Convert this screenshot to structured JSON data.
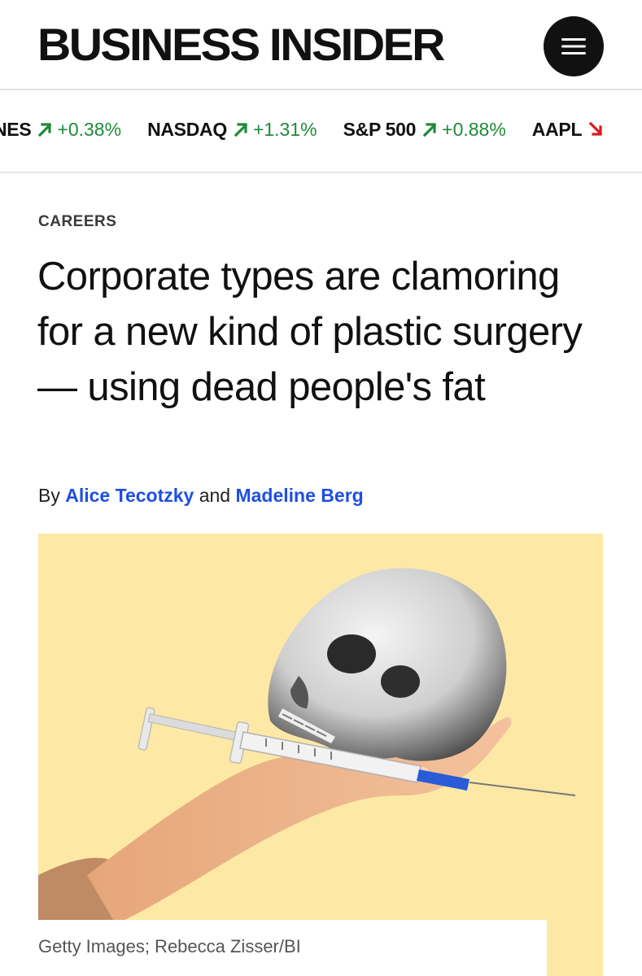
{
  "header": {
    "logo_text": "BUSINESS INSIDER",
    "menu_icon": "hamburger-menu-icon"
  },
  "ticker": {
    "items": [
      {
        "symbol": "NES",
        "change": "+0.38%",
        "direction": "up"
      },
      {
        "symbol": "NASDAQ",
        "change": "+1.31%",
        "direction": "up"
      },
      {
        "symbol": "S&P 500",
        "change": "+0.88%",
        "direction": "up"
      },
      {
        "symbol": "AAPL",
        "change": "",
        "direction": "down"
      }
    ],
    "up_color": "#1f8a3a",
    "down_color": "#d71c1c",
    "up_icon": "arrow-up-right-icon",
    "down_icon": "arrow-down-right-icon"
  },
  "article": {
    "kicker": "CAREERS",
    "headline": "Corporate types are clamoring for a new kind of plastic surgery — using dead people's fat",
    "byline": {
      "prefix": "By",
      "author1": "Alice Tecotzky",
      "joiner": "and",
      "author2": "Madeline Berg"
    },
    "image": {
      "caption": "Getty Images; Rebecca Zisser/BI",
      "background_color": "#fde9a5"
    }
  },
  "colors": {
    "link": "#1f4fe0",
    "text": "#111111",
    "divider": "#e2e2e2"
  }
}
